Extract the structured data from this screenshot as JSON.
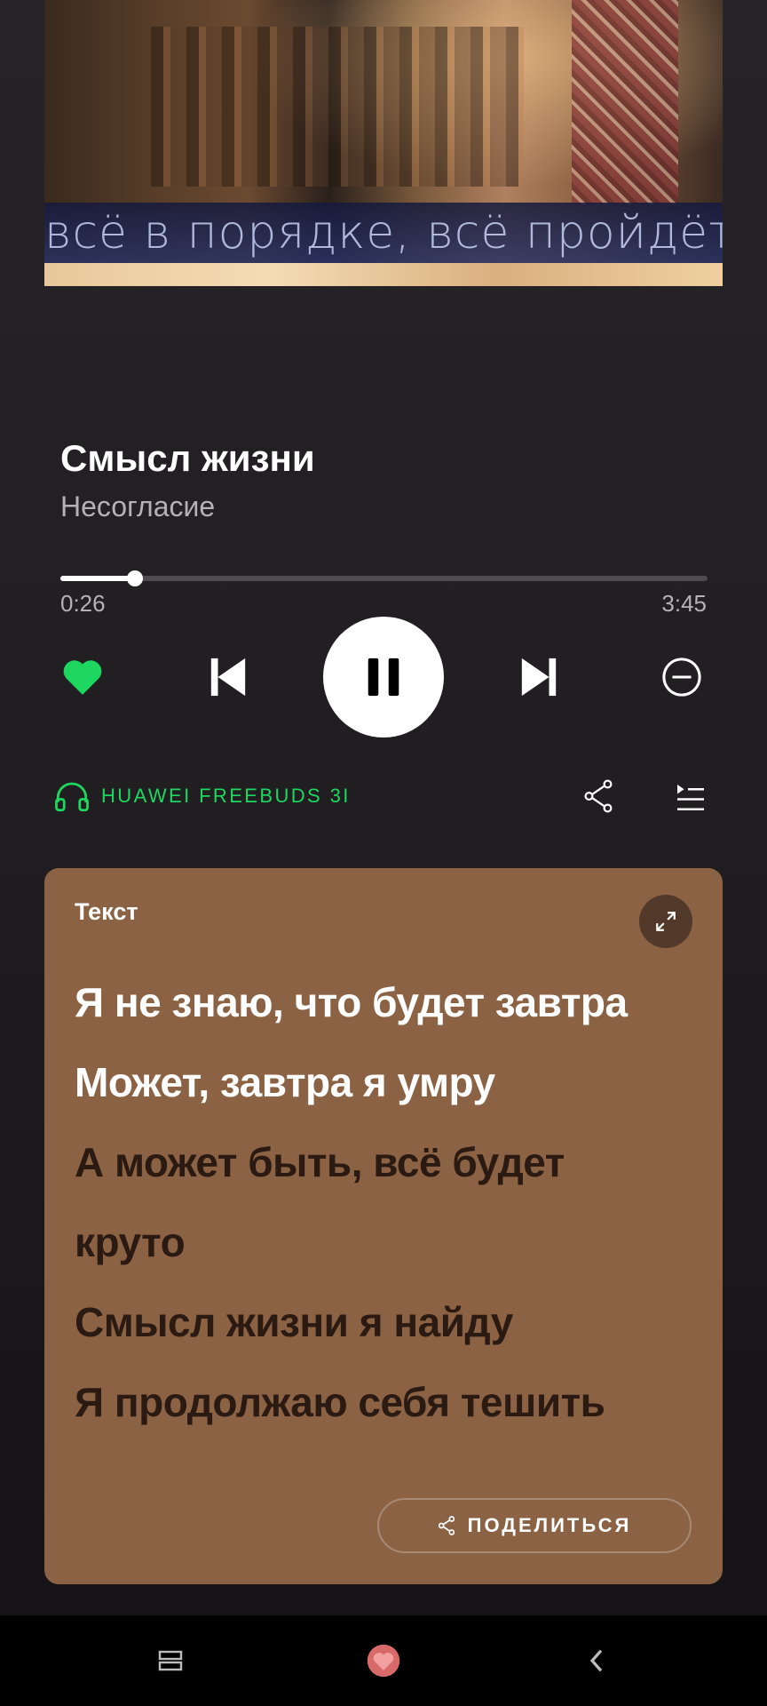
{
  "cover": {
    "banner_text": "всё в порядке, всё пройдёт"
  },
  "track": {
    "title": "Смысл жизни",
    "artist": "Несогласие"
  },
  "progress": {
    "current": "0:26",
    "total": "3:45",
    "fraction": 0.1156
  },
  "controls": {
    "like_icon": "heart-filled-icon",
    "prev_icon": "skip-previous-icon",
    "play_state_icon": "pause-icon",
    "next_icon": "skip-next-icon",
    "hide_icon": "minus-circle-icon"
  },
  "device": {
    "name": "HUAWEI FREEBUDS 3I",
    "icon": "headphones-icon"
  },
  "actions": {
    "share_icon": "share-icon",
    "queue_icon": "queue-icon"
  },
  "lyrics": {
    "header": "Текст",
    "lines": [
      {
        "text": "Я не знаю, что будет завтра",
        "state": "active"
      },
      {
        "text": "Может, завтра я умру",
        "state": "active"
      },
      {
        "text": "А может быть, всё будет",
        "state": "inactive"
      },
      {
        "text": "круто",
        "state": "inactive"
      },
      {
        "text": "Смысл жизни я найду",
        "state": "inactive"
      },
      {
        "text": "Я продолжаю себя тешить",
        "state": "inactive"
      }
    ],
    "share_label": "ПОДЕЛИТЬСЯ"
  },
  "colors": {
    "accent": "#1ed760",
    "lyrics_card": "#8b6244",
    "lyrics_inactive": "#2a1a12",
    "background": "#201e20"
  }
}
